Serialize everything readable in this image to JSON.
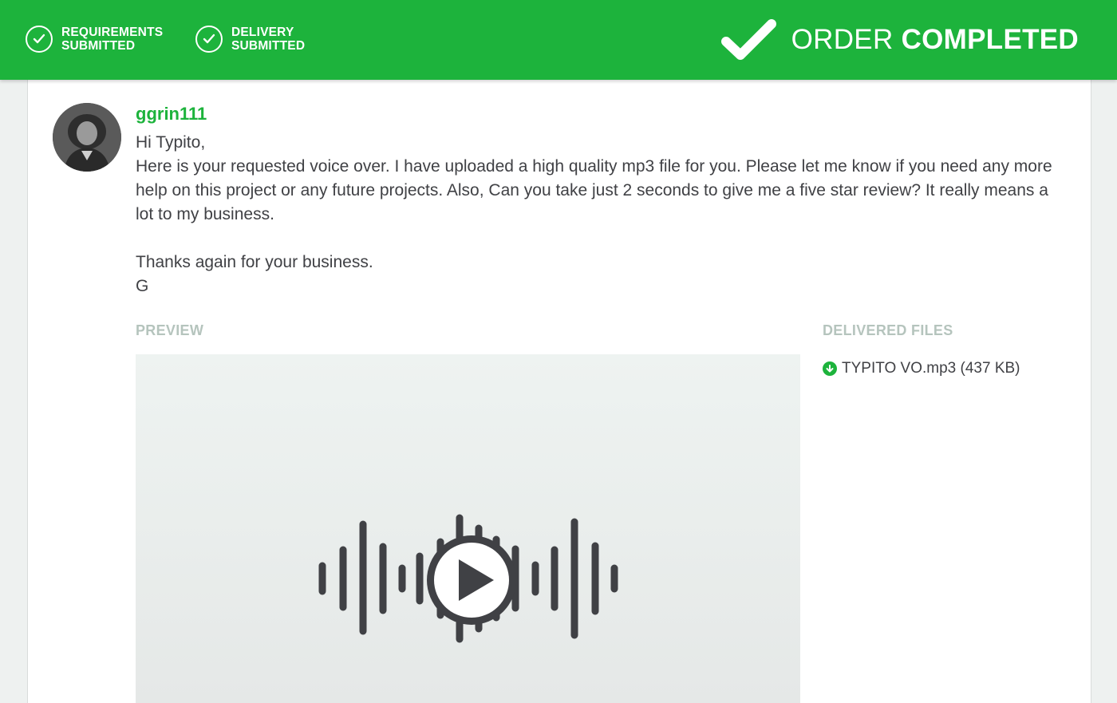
{
  "steps": [
    {
      "line1": "REQUIREMENTS",
      "line2": "SUBMITTED",
      "icon": "check-circle-icon"
    },
    {
      "line1": "DELIVERY",
      "line2": "SUBMITTED",
      "icon": "check-circle-icon"
    }
  ],
  "status": {
    "prefix": "ORDER",
    "emphasis": "COMPLETED",
    "icon": "big-check-icon"
  },
  "message": {
    "username": "ggrin111",
    "body": "Hi Typito,\nHere is your requested voice over. I have uploaded a high quality mp3 file for you. Please let me know if you need any more help on this project or any future projects. Also, Can you take just 2 seconds to give me a five star review? It really means a lot to my business.\n\nThanks again for your business.\nG"
  },
  "preview": {
    "heading": "PREVIEW"
  },
  "delivered": {
    "heading": "DELIVERED FILES",
    "files": [
      {
        "name": "TYPITO VO.mp3 (437 KB)",
        "icon": "download-icon"
      }
    ]
  },
  "colors": {
    "accent": "#1db33c",
    "text": "#404145",
    "muted": "#b5c4bd"
  }
}
